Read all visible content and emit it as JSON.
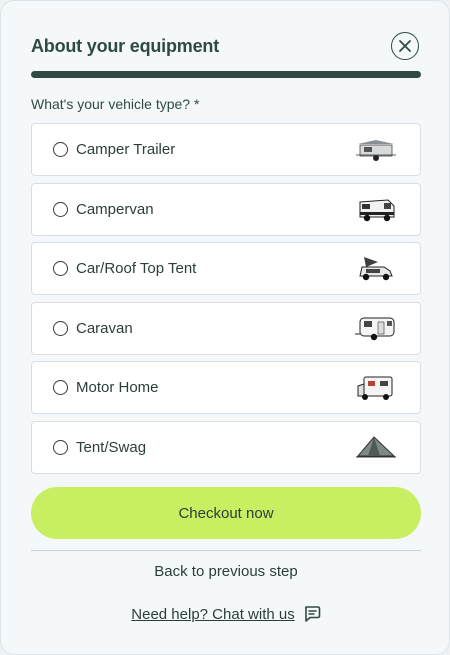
{
  "header": {
    "title": "About your equipment",
    "close_icon": "close-icon"
  },
  "progress": {
    "value": 1.0
  },
  "form": {
    "question": "What's your vehicle type? *",
    "options": [
      {
        "label": "Camper Trailer",
        "icon": "camper-trailer-image"
      },
      {
        "label": "Campervan",
        "icon": "campervan-image"
      },
      {
        "label": "Car/Roof Top Tent",
        "icon": "roof-top-tent-image"
      },
      {
        "label": "Caravan",
        "icon": "caravan-image"
      },
      {
        "label": "Motor Home",
        "icon": "motor-home-image"
      },
      {
        "label": "Tent/Swag",
        "icon": "tent-image"
      }
    ]
  },
  "actions": {
    "checkout_label": "Checkout now",
    "back_label": "Back to previous step",
    "help_label": "Need help? Chat with us",
    "help_icon": "chat-icon"
  },
  "colors": {
    "primary": "#2f4a45",
    "accent": "#c8ef62",
    "background": "#f5f8fa"
  }
}
